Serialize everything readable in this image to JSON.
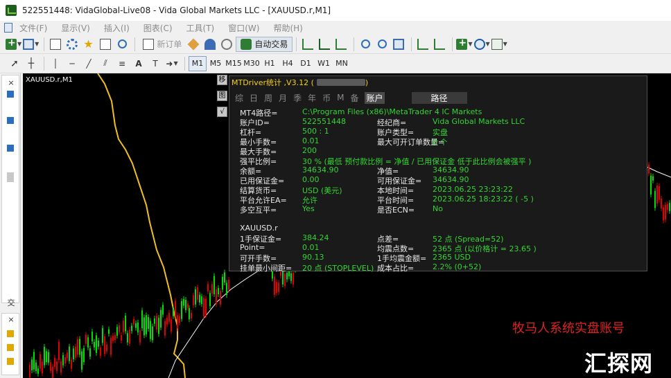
{
  "window": {
    "title": "522551448: VidaGlobal-Live08 - Vida Global Markets LLC - [XAUUSD.r,M1]"
  },
  "menu": [
    "文件(F)",
    "显示(V)",
    "插入(I)",
    "图表(C)",
    "工具(T)",
    "窗口(W)",
    "帮助(H)"
  ],
  "toolbar": {
    "new_order": "新订单",
    "auto_trading": "自动交易",
    "timeframes": [
      "M1",
      "M5",
      "M15",
      "M30",
      "H1",
      "H4",
      "D1",
      "W1",
      "MN"
    ],
    "active_timeframe": "M1"
  },
  "left_panel": {
    "tab_label": "交"
  },
  "chart": {
    "symbol_label": "XAUUSD.r,M1"
  },
  "side_tools": [
    "移",
    "图",
    "√"
  ],
  "panel": {
    "title": "MTDriver统计 ,V3.12 (",
    "title_close": ")",
    "tabs": [
      "综",
      "日",
      "周",
      "月",
      "季",
      "年",
      "币",
      "M",
      "备"
    ],
    "active_tab": "账户",
    "path_tab": "路径",
    "rows": [
      {
        "label": "MT4路径=",
        "value": "C:\\Program Files (x86)\\MetaTrader 4 IC Markets",
        "label2": "",
        "value2": ""
      },
      {
        "label": "账户ID=",
        "value": "522551448",
        "label2": "经纪商=",
        "value2": "Vida Global Markets LLC"
      },
      {
        "label": "杠杆=",
        "value": "500 : 1",
        "label2": "账户类型=",
        "value2": "实盘"
      },
      {
        "label": "最小手数=",
        "value": "0.01",
        "label2": "最大可开订单数量=",
        "value2": "0     个"
      },
      {
        "label": "最大手数=",
        "value": "200",
        "label2": "",
        "value2": ""
      },
      {
        "label": "强平比例=",
        "value": "30 %     (最低 预付款比例 = 净值 / 已用保证金   低于此比例会被强平 )",
        "label2": "",
        "value2": ""
      },
      {
        "label": "余额=",
        "value": "34634.90",
        "label2": "净值=",
        "value2": "34634.90"
      },
      {
        "label": "已用保证金=",
        "value": "0.00",
        "label2": "可用保证金=",
        "value2": "34634.90"
      },
      {
        "label": "结算货币=",
        "value": "USD (美元)",
        "label2": "本地时间=",
        "value2": "2023.06.25 23:23:22"
      },
      {
        "label": "平台允许EA=",
        "value": "允许",
        "label2": "平台时间=",
        "value2": "2023.06.25 18:23:22     ( -5 )"
      },
      {
        "label": "多空互平=",
        "value": "Yes",
        "label2": "是否ECN=",
        "value2": "No"
      }
    ],
    "symbol": "XAUUSD.r",
    "symbol_rows": [
      {
        "label": "1手保证金=",
        "value": "384.24",
        "label2": "点差=",
        "value2": "52 点    (Spread=52)"
      },
      {
        "label": "Point=",
        "value": "0.01",
        "label2": "均震点数=",
        "value2": "2365    点 (以价格计 = 23.65 )"
      },
      {
        "label": "可开手数=",
        "value": "90.13",
        "label2": "1手均震金额=",
        "value2": "2365    USD"
      },
      {
        "label": "挂单最小间距=",
        "value": "20 点  (STOPLEVEL)",
        "label2": "成本占比=",
        "value2": "2.2% (0+52)"
      }
    ]
  },
  "watermark": {
    "red_text": "牧马人系统实盘账号",
    "logo": "汇探网"
  },
  "colors": {
    "chart_bg": "#000000",
    "bull_candle": "#00e000",
    "bear_candle": "#e00000",
    "ma_yellow": "#f2c01c",
    "ma_white": "#ffffff",
    "panel_value": "#33d633",
    "panel_title": "#f5d20d"
  }
}
